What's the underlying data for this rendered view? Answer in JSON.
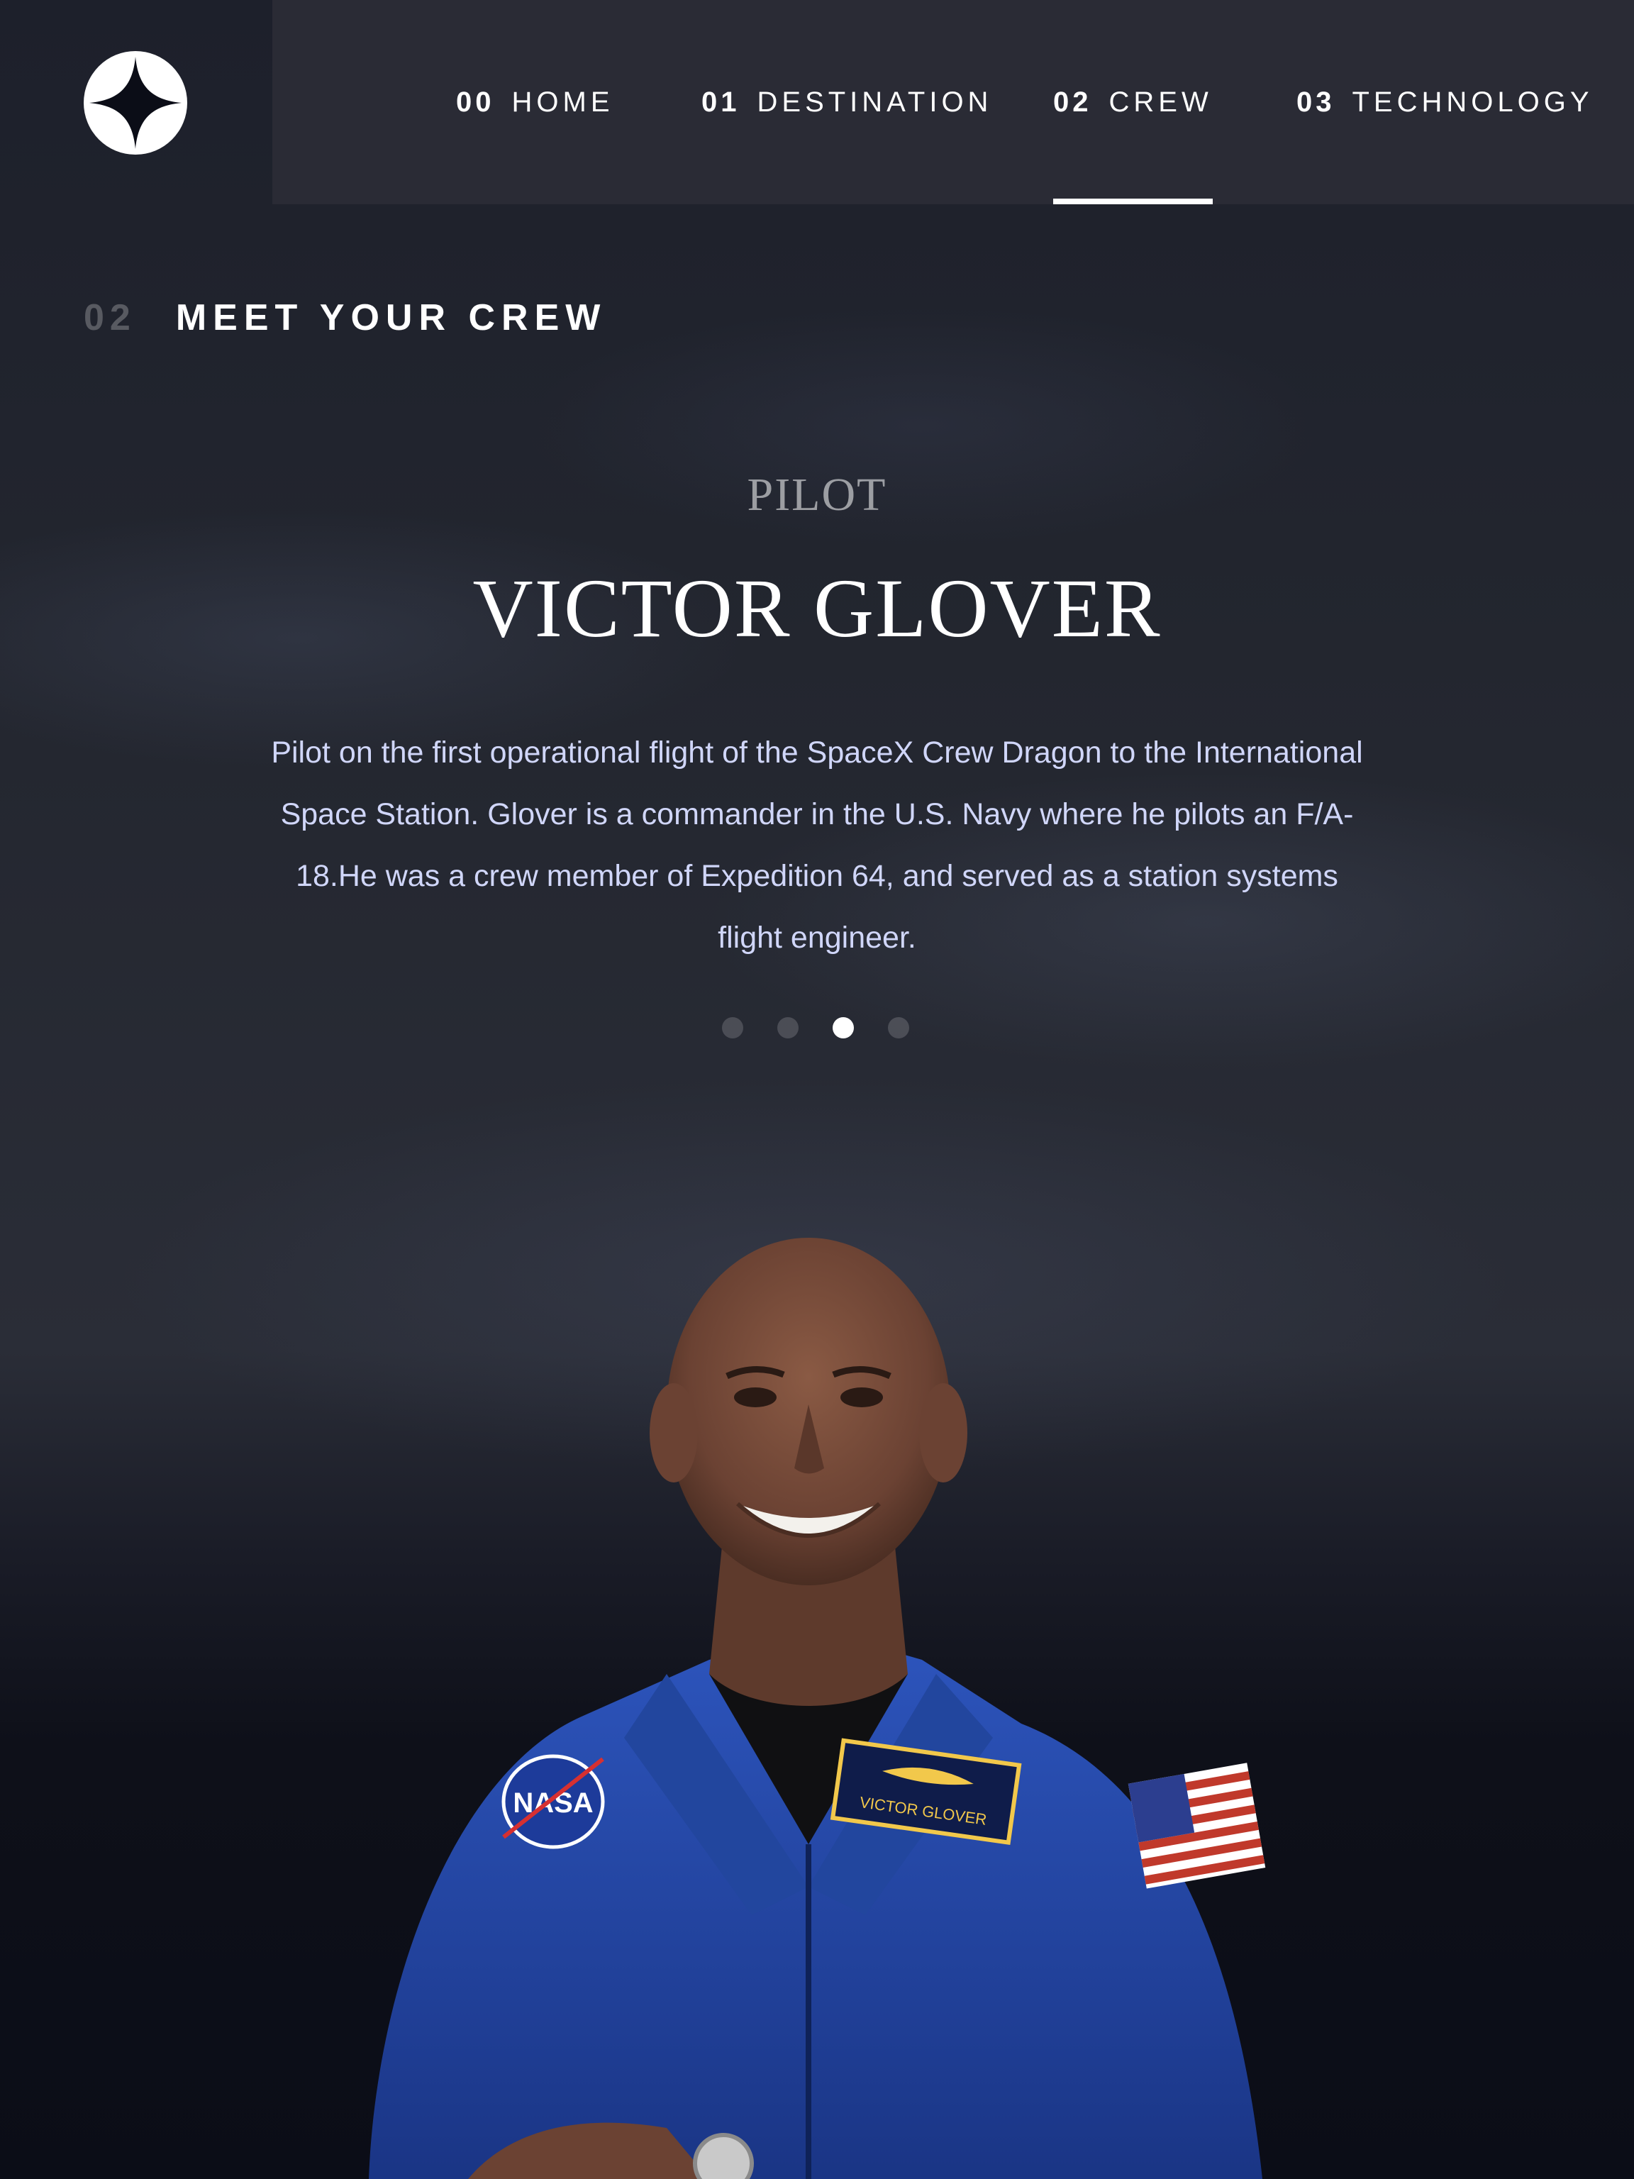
{
  "nav": {
    "items": [
      {
        "num": "00",
        "label": "HOME"
      },
      {
        "num": "01",
        "label": "DESTINATION"
      },
      {
        "num": "02",
        "label": "CREW"
      },
      {
        "num": "03",
        "label": "TECHNOLOGY"
      }
    ],
    "active_index": 2
  },
  "page": {
    "number": "02",
    "title": "MEET YOUR CREW"
  },
  "crew": {
    "role": "PILOT",
    "name": "VICTOR GLOVER",
    "bio": "Pilot on the first operational flight of the SpaceX Crew Dragon to the International Space Station. Glover is a commander in the U.S. Navy where he pilots an F/A-18.He was a crew member of Expedition 64, and served as a station systems flight engineer.",
    "dots": 4,
    "active_dot": 3,
    "badge": {
      "nasa": "NASA",
      "nametag": "VICTOR GLOVER"
    }
  },
  "colors": {
    "background": "#0b0d17",
    "accent_light": "#d0d6f9",
    "white": "#ffffff",
    "suit_blue": "#1e3f9a"
  },
  "icons": [
    "star-logo-icon"
  ]
}
